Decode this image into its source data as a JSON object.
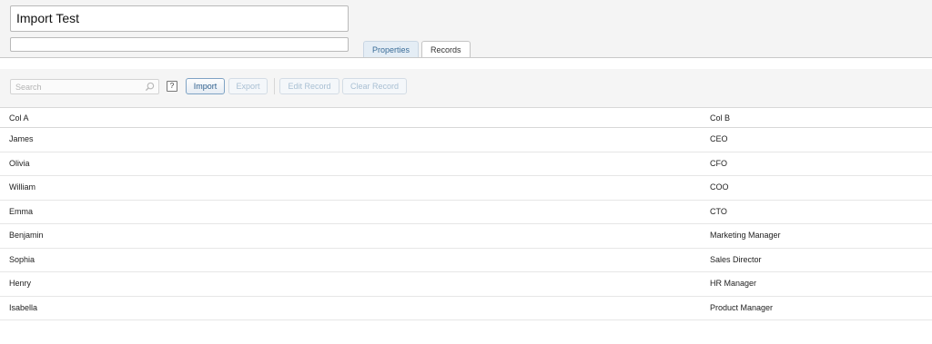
{
  "record": {
    "title": "Import Test",
    "description": ""
  },
  "tabs": [
    {
      "label": "Properties",
      "active": false
    },
    {
      "label": "Records",
      "active": true
    }
  ],
  "toolbar": {
    "search_placeholder": "Search",
    "help_label": "?",
    "import_label": "Import",
    "export_label": "Export",
    "edit_record_label": "Edit Record",
    "clear_record_label": "Clear Record"
  },
  "table": {
    "headers": [
      "Col A",
      "Col B"
    ],
    "rows": [
      [
        "James",
        "CEO"
      ],
      [
        "Olivia",
        "CFO"
      ],
      [
        "William",
        "COO"
      ],
      [
        "Emma",
        "CTO"
      ],
      [
        "Benjamin",
        "Marketing Manager"
      ],
      [
        "Sophia",
        "Sales Director"
      ],
      [
        "Henry",
        "HR Manager"
      ],
      [
        "Isabella",
        "Product Manager"
      ]
    ]
  },
  "colors": {
    "accent": "#3a6c98",
    "disabled": "#a8bfd3"
  }
}
